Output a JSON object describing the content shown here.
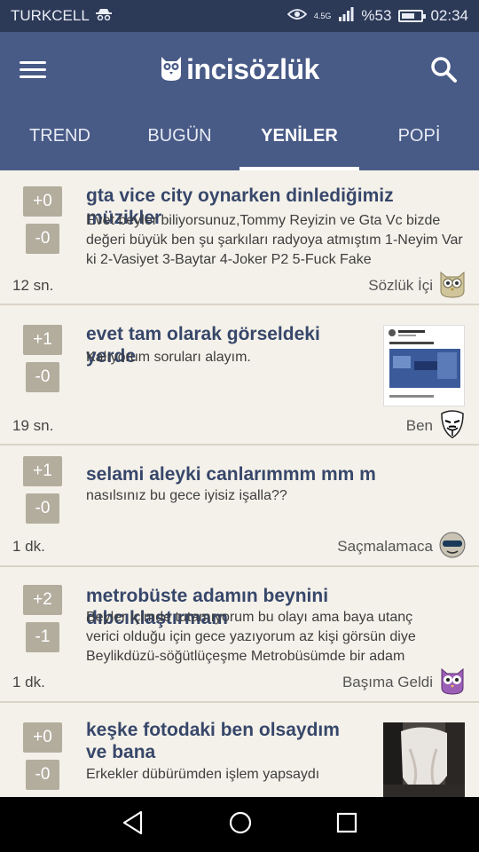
{
  "status_bar": {
    "carrier": "TURKCELL",
    "network": "4.5G",
    "battery_percent": "%53",
    "time": "02:34",
    "icons": [
      "incognito-icon",
      "eye-icon",
      "signal-icon",
      "battery-icon"
    ]
  },
  "app_bar": {
    "logo_text": "incisözlük",
    "menu_icon": "hamburger-menu-icon",
    "search_icon": "search-icon",
    "colors": {
      "app_bar": "#485a86",
      "status_bar": "#2c3957",
      "title_text": "#37476a",
      "vote_button": "#b3ad9e",
      "background": "#f4f1ea"
    }
  },
  "tabs": [
    {
      "label": "TREND",
      "active": false
    },
    {
      "label": "BUGÜN",
      "active": false
    },
    {
      "label": "YENİLER",
      "active": true
    },
    {
      "label": "POPİ",
      "active": false
    }
  ],
  "entries": [
    {
      "up": "+0",
      "down": "-0",
      "title": "gta vice city oynarken dinlediğimiz müzikler",
      "body": "Evet beyler biliyorsunuz,Tommy Reyizin ve Gta Vc bizde değeri büyük ben şu şarkıları radyoya atmıştım 1-Neyim Var ki 2-Vasiyet 3-Baytar 4-Joker P2 5-Fuck Fake",
      "time": "12 sn.",
      "category": "Sözlük İçi",
      "avatar": "owl-avatar-icon",
      "has_thumbnail": false
    },
    {
      "up": "+1",
      "down": "-0",
      "title": "evet tam olarak görseldeki yerde",
      "body": "Kalıyorum soruları alayım.",
      "time": "19 sn.",
      "category": "Ben",
      "avatar": "mask-avatar-icon",
      "has_thumbnail": true
    },
    {
      "up": "+1",
      "down": "-0",
      "title": "selami aleyki canlarımmm mm m",
      "body": "nasılsınız bu gece iyisiz işalla??",
      "time": "1 dk.",
      "category": "Saçmalamaca",
      "avatar": "sunglasses-face-avatar-icon",
      "has_thumbnail": false
    },
    {
      "up": "+2",
      "down": "-1",
      "title": "metrobüste adamın beynini dıbcıklaştırmam",
      "body": "Beyler içimde tutamıyorum bu olayı ama baya utanç verici olduğu için gece yazıyorum az kişi görsün diye Beylikdüzü-söğütlüçeşme Metrobüsümde bir adam",
      "time": "1 dk.",
      "category": "Başıma Geldi",
      "avatar": "purple-owl-avatar-icon",
      "has_thumbnail": false
    },
    {
      "up": "+0",
      "down": "-0",
      "title": "keşke fotodaki ben olsaydım ve bana",
      "body": "Erkekler dübürümden işlem yapsaydı",
      "time": "",
      "category": "",
      "avatar": "",
      "has_thumbnail": true
    }
  ],
  "nav_bar": {
    "icons": [
      "back-triangle-icon",
      "home-circle-icon",
      "recents-square-icon"
    ]
  }
}
